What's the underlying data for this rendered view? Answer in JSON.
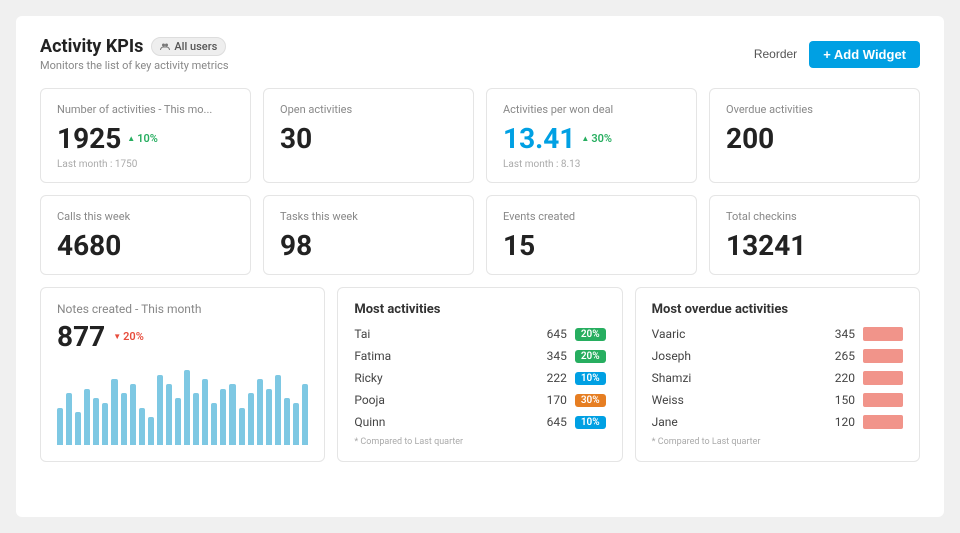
{
  "header": {
    "title": "Activity KPIs",
    "badge": "All users",
    "subtitle": "Monitors the list of key activity metrics",
    "reorder_label": "Reorder",
    "add_widget_label": "+ Add Widget"
  },
  "kpi_cards": [
    {
      "id": "num-activities",
      "label": "Number of activities - This mo...",
      "value": "1925",
      "badge": "10%",
      "sub": "Last month : 1750",
      "blue": false
    },
    {
      "id": "open-activities",
      "label": "Open activities",
      "value": "30",
      "badge": null,
      "sub": null,
      "blue": false
    },
    {
      "id": "activities-per-deal",
      "label": "Activities per won deal",
      "value": "13.41",
      "badge": "30%",
      "sub": "Last month : 8.13",
      "blue": true
    },
    {
      "id": "overdue-activities",
      "label": "Overdue activities",
      "value": "200",
      "badge": null,
      "sub": null,
      "blue": false
    },
    {
      "id": "calls-week",
      "label": "Calls this week",
      "value": "4680",
      "badge": null,
      "sub": null,
      "blue": false
    },
    {
      "id": "tasks-week",
      "label": "Tasks this week",
      "value": "98",
      "badge": null,
      "sub": null,
      "blue": false
    },
    {
      "id": "events-created",
      "label": "Events created",
      "value": "15",
      "badge": null,
      "sub": null,
      "blue": false
    },
    {
      "id": "total-checkins",
      "label": "Total checkins",
      "value": "13241",
      "badge": null,
      "sub": null,
      "blue": false
    }
  ],
  "notes_card": {
    "title": "Notes created - This month",
    "value": "877",
    "badge": "20%",
    "bars": [
      40,
      55,
      35,
      60,
      50,
      45,
      70,
      55,
      65,
      40,
      30,
      75,
      65,
      50,
      80,
      55,
      70,
      45,
      60,
      65,
      40,
      55,
      70,
      60,
      75,
      50,
      45,
      65
    ]
  },
  "most_activities": {
    "title": "Most activities",
    "compare_note": "* Compared to Last quarter",
    "rows": [
      {
        "name": "Tai",
        "count": "645",
        "badge": "20%",
        "badge_type": "green"
      },
      {
        "name": "Fatima",
        "count": "345",
        "badge": "20%",
        "badge_type": "green"
      },
      {
        "name": "Ricky",
        "count": "222",
        "badge": "10%",
        "badge_type": "blue"
      },
      {
        "name": "Pooja",
        "count": "170",
        "badge": "30%",
        "badge_type": "orange"
      },
      {
        "name": "Quinn",
        "count": "645",
        "badge": "10%",
        "badge_type": "blue"
      }
    ]
  },
  "most_overdue": {
    "title": "Most overdue activities",
    "compare_note": "* Compared to Last quarter",
    "rows": [
      {
        "name": "Vaaric",
        "count": "345"
      },
      {
        "name": "Joseph",
        "count": "265"
      },
      {
        "name": "Shamzi",
        "count": "220"
      },
      {
        "name": "Weiss",
        "count": "150"
      },
      {
        "name": "Jane",
        "count": "120"
      }
    ]
  }
}
